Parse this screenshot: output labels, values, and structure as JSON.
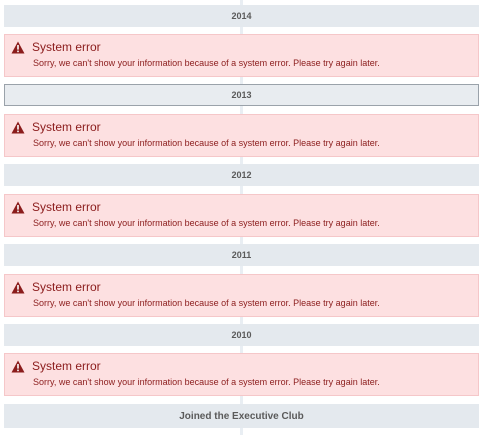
{
  "timeline": {
    "sections": [
      {
        "year": "2014",
        "error_title": "System error",
        "error_message": "Sorry, we can't show your information because of a system error. Please try again later."
      },
      {
        "year": "2013",
        "error_title": "System error",
        "error_message": "Sorry, we can't show your information because of a system error. Please try again later."
      },
      {
        "year": "2012",
        "error_title": "System error",
        "error_message": "Sorry, we can't show your information because of a system error. Please try again later."
      },
      {
        "year": "2011",
        "error_title": "System error",
        "error_message": "Sorry, we can't show your information because of a system error. Please try again later."
      },
      {
        "year": "2010",
        "error_title": "System error",
        "error_message": "Sorry, we can't show your information because of a system error. Please try again later."
      }
    ],
    "footer_label": "Joined the Executive Club"
  },
  "colors": {
    "error_bg": "#fde0e1",
    "error_text": "#8b1c1c",
    "year_bar_bg": "#e4e9ee"
  },
  "icons": {
    "error": "warning-triangle-icon"
  }
}
